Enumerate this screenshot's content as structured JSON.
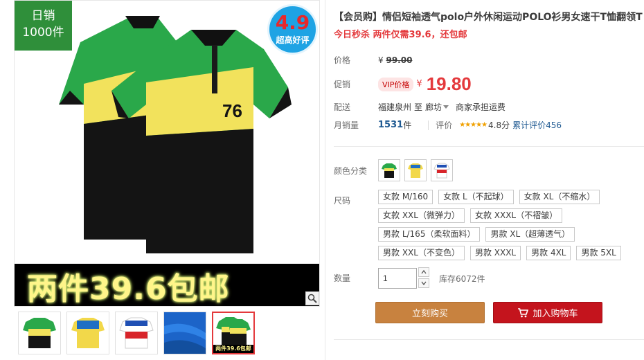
{
  "gallery": {
    "sold_badge": {
      "line1": "日销",
      "line2": "1000件",
      "color": "#2f8f3a"
    },
    "rating_badge": {
      "score": "4.9",
      "label": "超高好评"
    },
    "promo_banner": "两件39.6包邮",
    "shirt_number": "76",
    "thumbs": [
      {
        "name": "thumb-green-polo"
      },
      {
        "name": "thumb-yellow-polo"
      },
      {
        "name": "thumb-red-blue-polo"
      },
      {
        "name": "thumb-blue-fabric"
      },
      {
        "name": "thumb-couple-polo",
        "banner": "两件39.6包邮",
        "active": true
      }
    ]
  },
  "product": {
    "title": "【会员购】情侣短袖透气polo户外休闲运动POLO衫男女速干T恤翻领T",
    "subtitle": "今日秒杀 两件仅需39.6，还包邮",
    "price": {
      "label": "价格",
      "symbol": "¥",
      "value": "99.00"
    },
    "promo": {
      "label": "促销",
      "vip_tag": "VIP价格",
      "symbol": "¥",
      "value": "19.80"
    },
    "shipping": {
      "label": "配送",
      "from": "福建泉州",
      "to_word": "至",
      "dest": "廊坊",
      "note": "商家承担运费"
    },
    "sales": {
      "label": "月销量",
      "count": "1531",
      "unit": "件",
      "rating_label": "评价",
      "stars": "★★★★★",
      "score": "4.8分",
      "reviews": "累计评价456"
    },
    "color_label": "颜色分类",
    "size_label": "尺码",
    "sizes": [
      "女款 M/160",
      "女款 L（不起球）",
      "女款 XL（不缩水）",
      "女款 XXL（微弹力）",
      "女款 XXXL（不褶皱）",
      "男款 L/165（柔软面料）",
      "男款 XL（超薄透气）",
      "男款 XXL（不变色）",
      "男款 XXXL",
      "男款 4XL",
      "男款 5XL"
    ],
    "quantity": {
      "label": "数量",
      "value": "1",
      "stock": "库存6072件"
    },
    "buy_now": "立刻购买",
    "add_cart": "加入购物车"
  },
  "colors": {
    "accent_red": "#e4393c",
    "buy_orange": "#c8823f",
    "cart_red": "#c4141d"
  }
}
